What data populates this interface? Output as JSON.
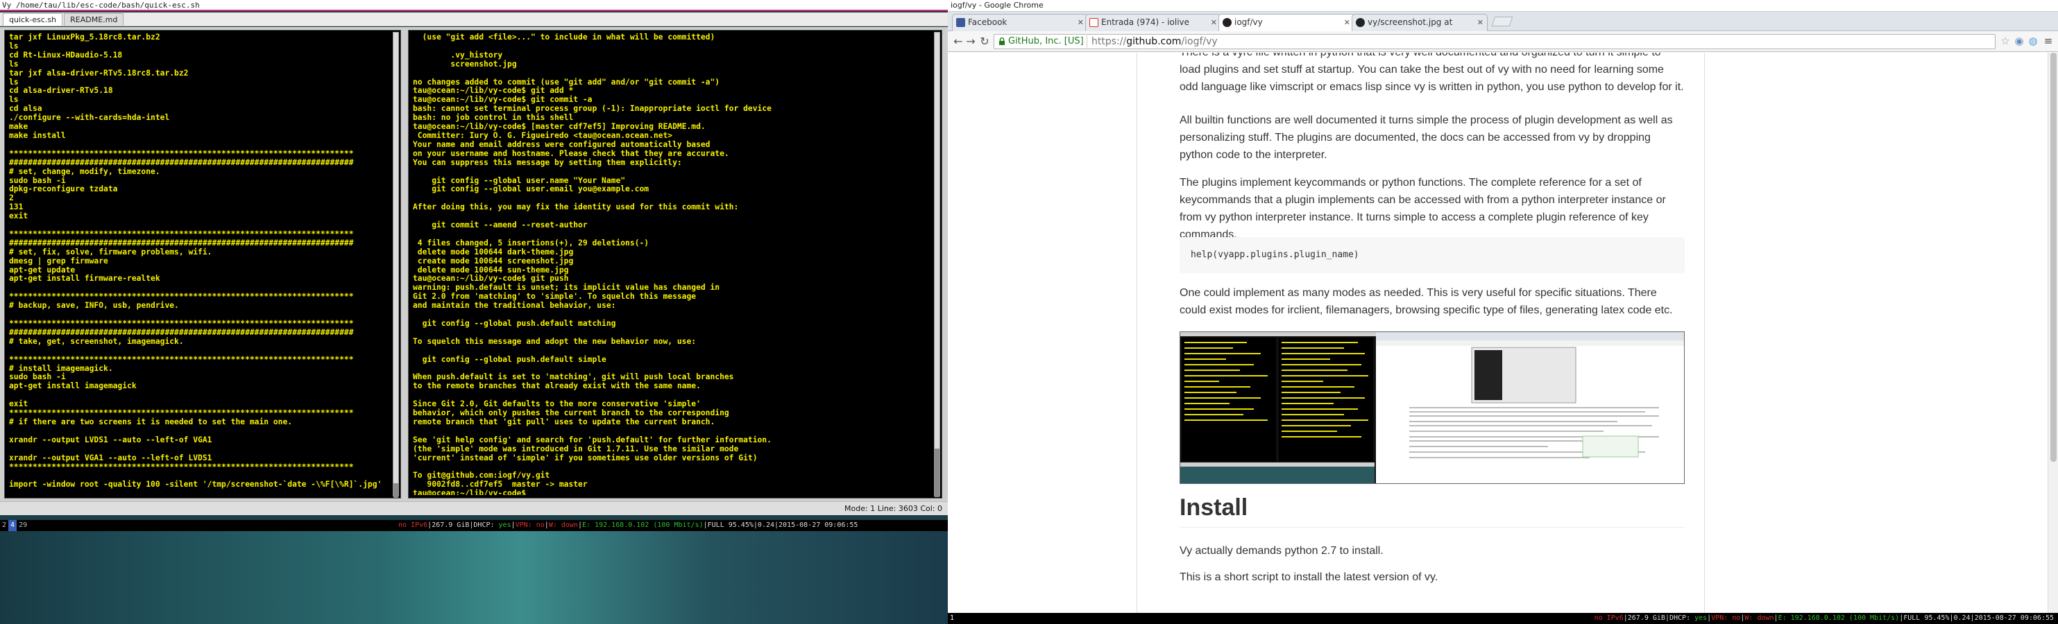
{
  "vy": {
    "title": "Vy /home/tau/lib/esc-code/bash/quick-esc.sh",
    "tabs": [
      "quick-esc.sh",
      "README.md"
    ],
    "left_lines": [
      "tar jxf LinuxPkg_5.18rc8.tar.bz2",
      "ls",
      "cd Rt-Linux-HDaudio-5.18",
      "ls",
      "tar jxf alsa-driver-RTv5.18rc8.tar.bz2",
      "ls",
      "cd alsa-driver-RTv5.18",
      "ls",
      "cd alsa",
      "./configure --with-cards=hda-intel",
      "make",
      "make install",
      "",
      "*************************************************************************",
      "#########################################################################",
      "# set, change, modify, timezone.",
      "sudo bash -i",
      "dpkg-reconfigure tzdata",
      "2",
      "131",
      "exit",
      "",
      "*************************************************************************",
      "#########################################################################",
      "# set, fix, solve, firmware problems, wifi.",
      "dmesg | grep firmware",
      "apt-get update",
      "apt-get install firmware-realtek",
      "",
      "*************************************************************************",
      "# backup, save, INFO, usb, pendrive.",
      "",
      "*************************************************************************",
      "#########################################################################",
      "# take, get, screenshot, imagemagick.",
      "",
      "*************************************************************************",
      "# install imagemagick.",
      "sudo bash -i",
      "apt-get install imagemagick",
      "",
      "exit",
      "*************************************************************************",
      "# if there are two screens it is needed to set the main one.",
      "",
      "xrandr --output LVDS1 --auto --left-of VGA1",
      "",
      "xrandr --output VGA1 --auto --left-of LVDS1",
      "*************************************************************************",
      "",
      "import -window root -quality 100 -silent '/tmp/screenshot-`date -\\%F[\\%R]`.jpg'",
      "",
      ""
    ],
    "right_lines": [
      "  (use \"git add <file>...\" to include in what will be committed)",
      "",
      "        .vy_history",
      "        screenshot.jpg",
      "",
      "no changes added to commit (use \"git add\" and/or \"git commit -a\")",
      "tau@ocean:~/lib/vy-code$ git add *",
      "tau@ocean:~/lib/vy-code$ git commit -a",
      "bash: cannot set terminal process group (-1): Inappropriate ioctl for device",
      "bash: no job control in this shell",
      "tau@ocean:~/lib/vy-code$ [master cdf7ef5] Improving README.md.",
      " Committer: Iury O. G. Figueiredo <tau@ocean.ocean.net>",
      "Your name and email address were configured automatically based",
      "on your username and hostname. Please check that they are accurate.",
      "You can suppress this message by setting them explicitly:",
      "",
      "    git config --global user.name \"Your Name\"",
      "    git config --global user.email you@example.com",
      "",
      "After doing this, you may fix the identity used for this commit with:",
      "",
      "    git commit --amend --reset-author",
      "",
      " 4 files changed, 5 insertions(+), 29 deletions(-)",
      " delete mode 100644 dark-theme.jpg",
      " create mode 100644 screenshot.jpg",
      " delete mode 100644 sun-theme.jpg",
      "tau@ocean:~/lib/vy-code$ git push",
      "warning: push.default is unset; its implicit value has changed in",
      "Git 2.0 from 'matching' to 'simple'. To squelch this message",
      "and maintain the traditional behavior, use:",
      "",
      "  git config --global push.default matching",
      "",
      "To squelch this message and adopt the new behavior now, use:",
      "",
      "  git config --global push.default simple",
      "",
      "When push.default is set to 'matching', git will push local branches",
      "to the remote branches that already exist with the same name.",
      "",
      "Since Git 2.0, Git defaults to the more conservative 'simple'",
      "behavior, which only pushes the current branch to the corresponding",
      "remote branch that 'git pull' uses to update the current branch.",
      "",
      "See 'git help config' and search for 'push.default' for further information.",
      "(the 'simple' mode was introduced in Git 1.7.11. Use the similar mode",
      "'current' instead of 'simple' if you sometimes use older versions of Git)",
      "",
      "To git@github.com:iogf/vy.git",
      "   9002fd8..cdf7ef5  master -> master",
      "tau@ocean:~/lib/vy-code$"
    ],
    "status": "Mode: 1 Line: 3603 Col: 0"
  },
  "wm": {
    "workspaces": [
      "2",
      "4",
      "29"
    ],
    "workspace_right": "1",
    "status": {
      "ipv6": "no IPv6",
      "disk": "267.9 GiB",
      "dhcp_label": "DHCP: ",
      "dhcp_val": "yes",
      "vpn": "VPN: ",
      "vpn_val": "no",
      "w": "W: down",
      "e": "E: 192.168.0.102 (100 Mbit/s)",
      "full": "FULL 95.45%",
      "load": "0.24",
      "time": "2015-08-27 09:06:55"
    }
  },
  "chrome": {
    "title": "iogf/vy - Google Chrome",
    "tabs": [
      {
        "label": "Facebook",
        "fav": "#3b5998"
      },
      {
        "label": "Entrada (974) - iolive",
        "fav": "#d93025"
      },
      {
        "label": "iogf/vy",
        "fav": "#222222"
      },
      {
        "label": "vy/screenshot.jpg at",
        "fav": "#222222"
      }
    ],
    "ev_label": "GitHub, Inc. [US]",
    "url_scheme": "https://",
    "url_host": "github.com",
    "url_path": "/iogf/vy"
  },
  "article": {
    "p1": "There is a vyrc file written in python that is very well documented and organized to turn it simple to load plugins and set stuff at startup. You can take the best out of vy with no need for learning some odd language like vimscript or emacs lisp since vy is written in python, you use python to develop for it.",
    "p2": "All builtin functions are well documented it turns simple the process of plugin development as well as personalizing stuff. The plugins are documented, the docs can be accessed from vy by dropping python code to the interpreter.",
    "p3": "The plugins implement keycommands or python functions. The complete reference for a set of keycommands that a plugin implements can be accessed with from a python interpreter instance or from vy python interpreter instance. It turns simple to access a complete plugin reference of key commands.",
    "code": "help(vyapp.plugins.plugin_name)",
    "p4": "One could implement as many modes as needed. This is very useful for specific situations. There could exist modes for irclient, filemanagers, browsing specific type of files, generating latex code etc.",
    "install_heading": "Install",
    "p5": "Vy actually demands python 2.7 to install.",
    "p6": "This is a short script to install the latest version of vy."
  },
  "colors": {
    "editor_text": "#f7f100",
    "accent_pink": "#d6287e",
    "ev_green": "#1f7a1f"
  }
}
